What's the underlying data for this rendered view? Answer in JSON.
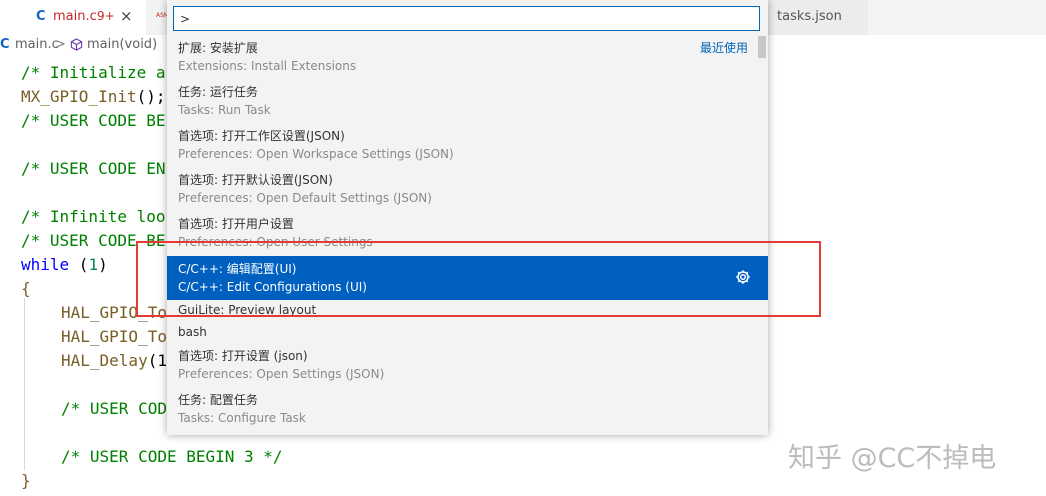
{
  "tabs": {
    "active": {
      "icon": "C",
      "title": "main.c",
      "badge": "9+",
      "close": "×"
    },
    "asm_label": "ASM",
    "right_tab": "tasks.json"
  },
  "breadcrumb": {
    "icon": "C",
    "file": "main.c",
    "sep": ">",
    "func": "main(void)"
  },
  "code": {
    "line1": "/* Initialize a",
    "line2_fn": "MX_GPIO_Init",
    "line2_rest": "();",
    "line3": "/* USER CODE BE",
    "line4": "/* USER CODE EN",
    "line5": "/* Infinite loo",
    "line6": "/* USER CODE BE",
    "line7_kw": "while",
    "line7_open": " (",
    "line7_num": "1",
    "line7_close": ")",
    "line8": "{",
    "line9": "HAL_GPIO_To",
    "line10": "HAL_GPIO_To",
    "line11_fn": "HAL_Delay",
    "line11_rest": "(1",
    "line12": "/* USER CODE",
    "line13": "/* USER CODE BEGIN 3 */",
    "line14": "}"
  },
  "palette": {
    "input_value": ">",
    "recent_label": "最近使用",
    "items": [
      {
        "label": "扩展: 安装扩展",
        "detail": "Extensions: Install Extensions"
      },
      {
        "label": "任务: 运行任务",
        "detail": "Tasks: Run Task"
      },
      {
        "label": "首选项: 打开工作区设置(JSON)",
        "detail": "Preferences: Open Workspace Settings (JSON)"
      },
      {
        "label": "首选项: 打开默认设置(JSON)",
        "detail": "Preferences: Open Default Settings (JSON)"
      },
      {
        "label": "首选项: 打开用户设置",
        "detail": "Preferences: Open User Settings"
      },
      {
        "label": "C/C++: 编辑配置(UI)",
        "detail": "C/C++: Edit Configurations (UI)"
      },
      {
        "label": "GuiLite: Preview layout"
      },
      {
        "label": "bash"
      },
      {
        "label": "首选项: 打开设置 (json)",
        "detail": "Preferences: Open Settings (JSON)"
      },
      {
        "label": "任务: 配置任务",
        "detail": "Tasks: Configure Task"
      }
    ]
  },
  "watermark": "知乎 @CC不掉电",
  "colors": {
    "accent": "#0060c0",
    "highlight_box": "#e53935",
    "comment": "#008000",
    "keyword": "#0000ff"
  },
  "icons": {
    "selected_item_action": "gear-icon",
    "breadcrumb_symbol": "cube-icon"
  }
}
